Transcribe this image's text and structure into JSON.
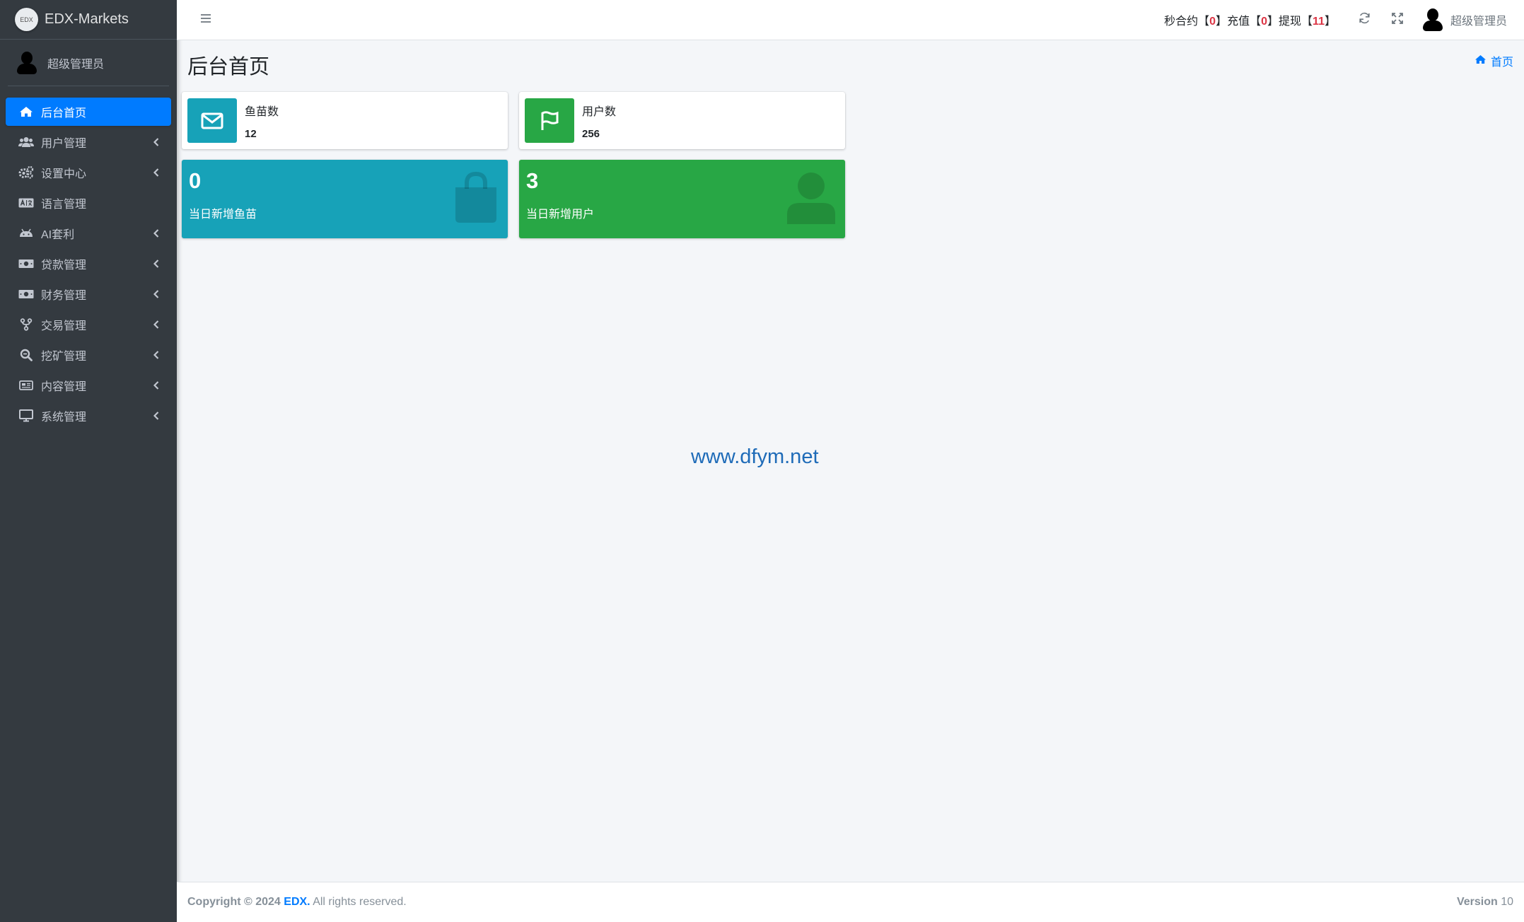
{
  "brand": {
    "logo_text": "EDX",
    "name": "EDX-Markets"
  },
  "sidebar": {
    "user_name": "超级管理员",
    "items": [
      {
        "label": "后台首页",
        "icon": "home-icon",
        "active": true,
        "has_children": false
      },
      {
        "label": "用户管理",
        "icon": "users-icon",
        "has_children": true
      },
      {
        "label": "设置中心",
        "icon": "cogs-icon",
        "has_children": true
      },
      {
        "label": "语言管理",
        "icon": "language-icon",
        "has_children": false
      },
      {
        "label": "AI套利",
        "icon": "android-icon",
        "has_children": true
      },
      {
        "label": "贷款管理",
        "icon": "money-icon",
        "has_children": true
      },
      {
        "label": "财务管理",
        "icon": "money-icon",
        "has_children": true
      },
      {
        "label": "交易管理",
        "icon": "transaction-icon",
        "has_children": true
      },
      {
        "label": "挖矿管理",
        "icon": "search-icon",
        "has_children": true
      },
      {
        "label": "内容管理",
        "icon": "newspaper-icon",
        "has_children": true
      },
      {
        "label": "系统管理",
        "icon": "desktop-icon",
        "has_children": true
      }
    ]
  },
  "topbar": {
    "stats": {
      "contract_label": "秒合约",
      "contract_value": "0",
      "recharge_label": "充值",
      "recharge_value": "0",
      "withdraw_label": "提现",
      "withdraw_value": "11",
      "open_bracket": "【",
      "close_bracket": "】"
    },
    "user_name": "超级管理员"
  },
  "page": {
    "title": "后台首页",
    "breadcrumb": "首页"
  },
  "info_boxes": [
    {
      "label": "鱼苗数",
      "value": "12",
      "color": "#17a2b8",
      "icon": "envelope-icon"
    },
    {
      "label": "用户数",
      "value": "256",
      "color": "#28a745",
      "icon": "flag-icon"
    }
  ],
  "small_boxes": [
    {
      "value": "0",
      "label": "当日新增鱼苗",
      "color": "#17a2b8",
      "icon": "shopping-bag-icon"
    },
    {
      "value": "3",
      "label": "当日新增用户",
      "color": "#28a745",
      "icon": "user-icon"
    }
  ],
  "watermark": "www.dfym.net",
  "footer": {
    "copyright_prefix": "Copyright © 2024",
    "company": "EDX.",
    "rights": "All rights reserved.",
    "version_label": "Version",
    "version_value": "10"
  }
}
